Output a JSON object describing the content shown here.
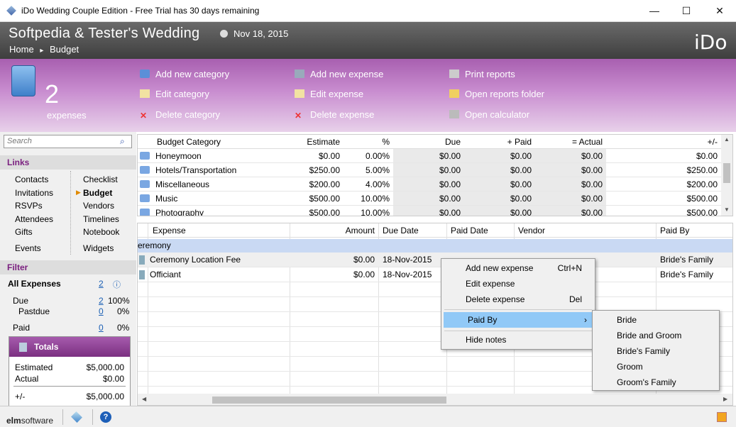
{
  "window": {
    "title": "iDo Wedding Couple Edition - Free Trial has 30 days remaining",
    "minimize": "—",
    "maximize": "☐",
    "close": "✕"
  },
  "header": {
    "wedding_title": "Softpedia & Tester's Wedding",
    "date": "Nov 18, 2015",
    "breadcrumb_home": "Home",
    "breadcrumb_sep": "▸",
    "breadcrumb_current": "Budget",
    "logo": "iDo"
  },
  "toolbar": {
    "count": "2",
    "count_label": "expenses",
    "col1": [
      "Add new category",
      "Edit category",
      "Delete category"
    ],
    "col2": [
      "Add new expense",
      "Edit expense",
      "Delete expense"
    ],
    "col3": [
      "Print reports",
      "Open reports folder",
      "Open calculator"
    ]
  },
  "sidebar": {
    "search_placeholder": "Search",
    "links_header": "Links",
    "links_left": [
      "Contacts",
      "Invitations",
      "RSVPs",
      "Attendees",
      "Gifts",
      "Events"
    ],
    "links_right": [
      "Checklist",
      "Budget",
      "Vendors",
      "Timelines",
      "Notebook",
      "Widgets"
    ],
    "filter_header": "Filter",
    "filter": {
      "all_label": "All Expenses",
      "all_count": "2",
      "due_label": "Due",
      "due_count": "2",
      "due_pct": "100%",
      "pastdue_label": "Pastdue",
      "pastdue_count": "0",
      "pastdue_pct": "0%",
      "paid_label": "Paid",
      "paid_count": "0",
      "paid_pct": "0%"
    },
    "totals": {
      "title": "Totals",
      "estimated_label": "Estimated",
      "estimated": "$5,000.00",
      "actual_label": "Actual",
      "actual": "$0.00",
      "diff_label": "+/-",
      "diff": "$5,000.00"
    }
  },
  "categories": {
    "headers": [
      "Budget Category",
      "Estimate",
      "%",
      "Due",
      "+ Paid",
      "= Actual",
      "+/-"
    ],
    "rows": [
      [
        "Honeymoon",
        "$0.00",
        "0.00%",
        "$0.00",
        "$0.00",
        "$0.00",
        "$0.00"
      ],
      [
        "Hotels/Transportation",
        "$250.00",
        "5.00%",
        "$0.00",
        "$0.00",
        "$0.00",
        "$250.00"
      ],
      [
        "Miscellaneous",
        "$200.00",
        "4.00%",
        "$0.00",
        "$0.00",
        "$0.00",
        "$200.00"
      ],
      [
        "Music",
        "$500.00",
        "10.00%",
        "$0.00",
        "$0.00",
        "$0.00",
        "$500.00"
      ],
      [
        "Photography",
        "$500.00",
        "10.00%",
        "$0.00",
        "$0.00",
        "$0.00",
        "$500.00"
      ]
    ]
  },
  "expenses": {
    "headers": [
      "Expense",
      "Amount",
      "Due Date",
      "Paid Date",
      "Vendor",
      "Paid By"
    ],
    "group": "eremony",
    "rows": [
      [
        "Ceremony Location Fee",
        "$0.00",
        "18-Nov-2015",
        "",
        "",
        "Bride's Family"
      ],
      [
        "Officiant",
        "$0.00",
        "18-Nov-2015",
        "",
        "",
        "Bride's Family"
      ]
    ]
  },
  "context_menu": {
    "items": [
      {
        "label": "Add new expense",
        "key": "Ctrl+N"
      },
      {
        "label": "Edit expense",
        "key": ""
      },
      {
        "label": "Delete expense",
        "key": "Del"
      },
      {
        "label": "Paid By",
        "key": "›"
      },
      {
        "label": "Hide notes",
        "key": ""
      }
    ]
  },
  "submenu": {
    "items": [
      "Bride",
      "Bride and Groom",
      "Bride's Family",
      "Groom",
      "Groom's Family"
    ]
  },
  "status": {
    "brand_elm": "elm",
    "brand_software": "software",
    "help": "?"
  }
}
